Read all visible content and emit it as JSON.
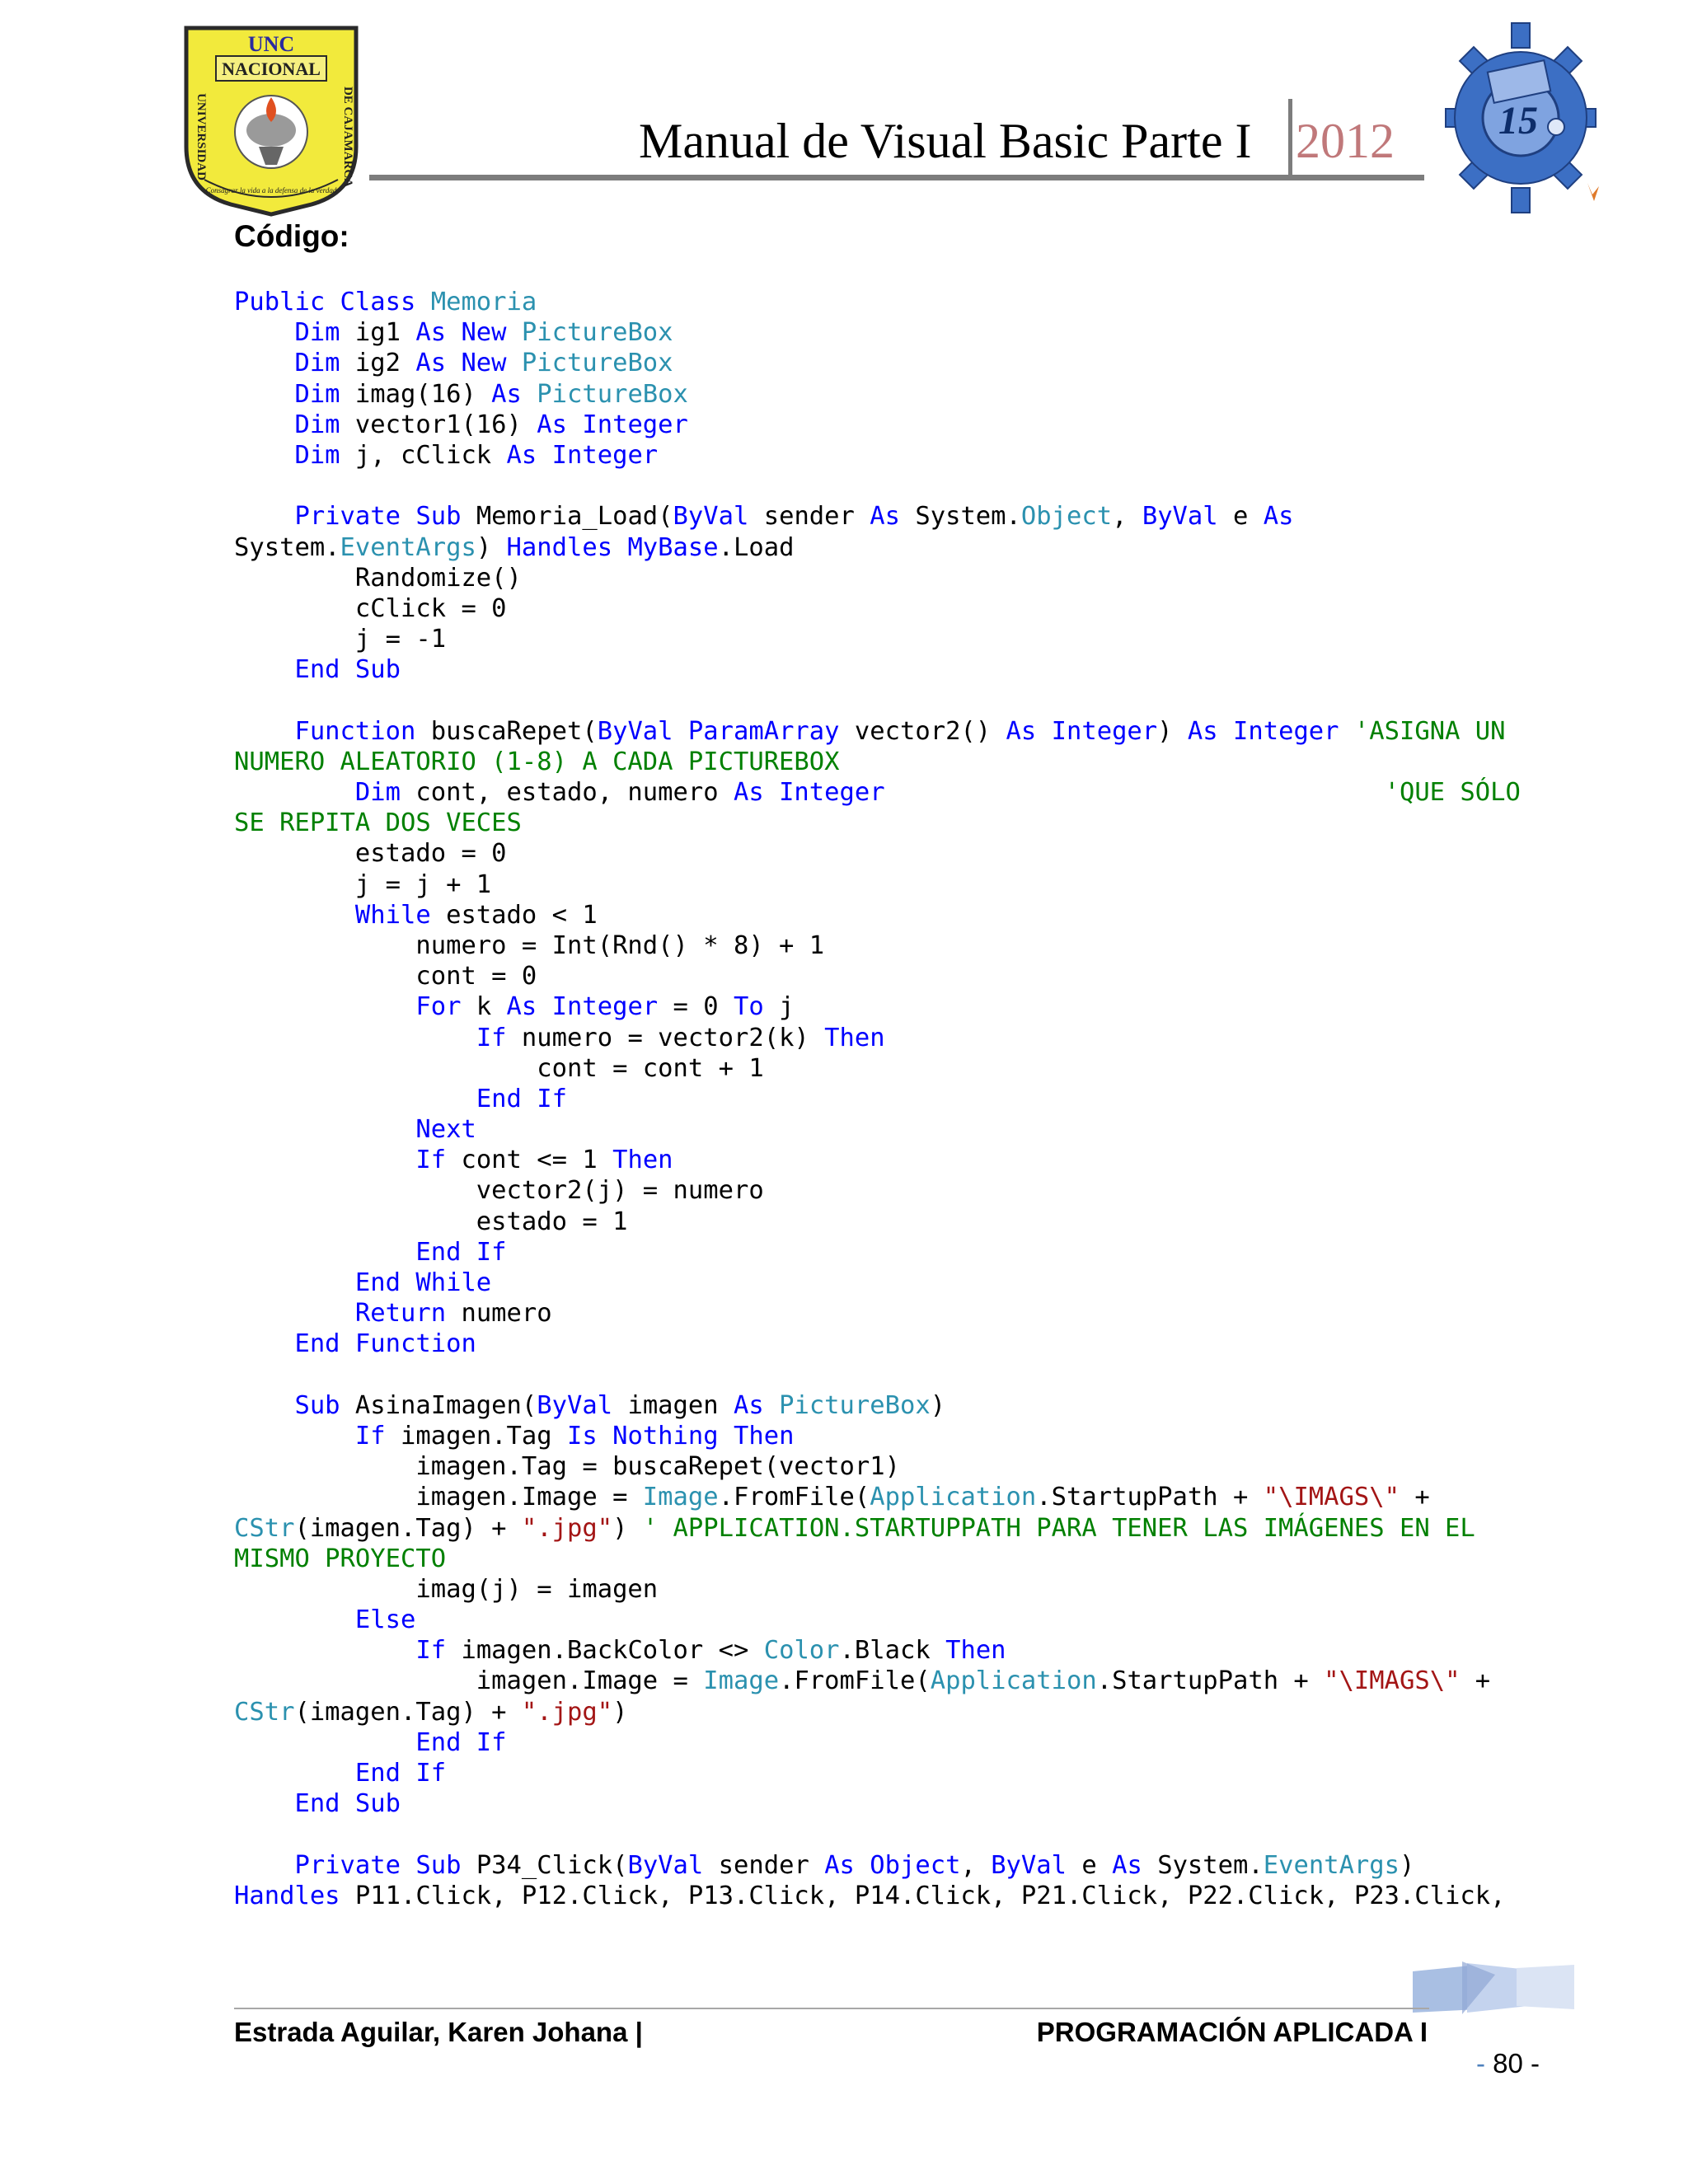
{
  "header": {
    "title": "Manual de Visual Basic Parte I",
    "year": "2012",
    "left_logo": {
      "name": "UNC Nacional de Cajamarca seal",
      "text_top": "UNC",
      "text_banner": "NACIONAL",
      "text_left": "UNIVERSIDAD",
      "text_right": "DE CAJAMARCA",
      "motto": "Consagrar la vida a la defensa de la verdad",
      "color_primary": "#f2ea3c",
      "color_border": "#2a2a2a"
    },
    "right_logo": {
      "name": "gear emblem logo",
      "text": "15",
      "color_primary": "#3c6fc4"
    }
  },
  "section_heading": "Código:",
  "code": {
    "colors": {
      "keyword": "#0000ff",
      "type": "#2b91af",
      "comment": "#008000",
      "string": "#a31515",
      "plain": "#000000"
    },
    "lines": [
      [
        [
          "k",
          "Public Class "
        ],
        [
          "t",
          "Memoria"
        ]
      ],
      [
        [
          "p",
          "    "
        ],
        [
          "k",
          "Dim "
        ],
        [
          "p",
          "ig1 "
        ],
        [
          "k",
          "As New "
        ],
        [
          "t",
          "PictureBox"
        ]
      ],
      [
        [
          "p",
          "    "
        ],
        [
          "k",
          "Dim "
        ],
        [
          "p",
          "ig2 "
        ],
        [
          "k",
          "As New "
        ],
        [
          "t",
          "PictureBox"
        ]
      ],
      [
        [
          "p",
          "    "
        ],
        [
          "k",
          "Dim "
        ],
        [
          "p",
          "imag(16) "
        ],
        [
          "k",
          "As "
        ],
        [
          "t",
          "PictureBox"
        ]
      ],
      [
        [
          "p",
          "    "
        ],
        [
          "k",
          "Dim "
        ],
        [
          "p",
          "vector1(16) "
        ],
        [
          "k",
          "As Integer"
        ]
      ],
      [
        [
          "p",
          "    "
        ],
        [
          "k",
          "Dim "
        ],
        [
          "p",
          "j, cClick "
        ],
        [
          "k",
          "As Integer"
        ]
      ],
      [],
      [
        [
          "p",
          "    "
        ],
        [
          "k",
          "Private Sub "
        ],
        [
          "p",
          "Memoria_Load("
        ],
        [
          "k",
          "ByVal "
        ],
        [
          "p",
          "sender "
        ],
        [
          "k",
          "As "
        ],
        [
          "p",
          "System."
        ],
        [
          "t",
          "Object"
        ],
        [
          "p",
          ", "
        ],
        [
          "k",
          "ByVal "
        ],
        [
          "p",
          "e "
        ],
        [
          "k",
          "As"
        ]
      ],
      [
        [
          "p",
          "System."
        ],
        [
          "t",
          "EventArgs"
        ],
        [
          "p",
          ") "
        ],
        [
          "k",
          "Handles MyBase"
        ],
        [
          "p",
          ".Load"
        ]
      ],
      [
        [
          "p",
          "        Randomize()"
        ]
      ],
      [
        [
          "p",
          "        cClick = 0"
        ]
      ],
      [
        [
          "p",
          "        j = -1"
        ]
      ],
      [
        [
          "p",
          "    "
        ],
        [
          "k",
          "End Sub"
        ]
      ],
      [],
      [
        [
          "p",
          "    "
        ],
        [
          "k",
          "Function "
        ],
        [
          "p",
          "buscaRepet("
        ],
        [
          "k",
          "ByVal ParamArray "
        ],
        [
          "p",
          "vector2() "
        ],
        [
          "k",
          "As Integer"
        ],
        [
          "p",
          ") "
        ],
        [
          "k",
          "As Integer "
        ],
        [
          "c",
          "'ASIGNA UN"
        ]
      ],
      [
        [
          "c",
          "NUMERO ALEATORIO (1-8) A CADA PICTUREBOX"
        ]
      ],
      [
        [
          "p",
          "        "
        ],
        [
          "k",
          "Dim "
        ],
        [
          "p",
          "cont, estado, numero "
        ],
        [
          "k",
          "As Integer"
        ],
        [
          "p",
          "                                 "
        ],
        [
          "c",
          "'QUE SÓLO"
        ]
      ],
      [
        [
          "c",
          "SE REPITA DOS VECES"
        ]
      ],
      [
        [
          "p",
          "        estado = 0"
        ]
      ],
      [
        [
          "p",
          "        j = j + 1"
        ]
      ],
      [
        [
          "p",
          "        "
        ],
        [
          "k",
          "While "
        ],
        [
          "p",
          "estado < 1"
        ]
      ],
      [
        [
          "p",
          "            numero = Int(Rnd() * 8) + 1"
        ]
      ],
      [
        [
          "p",
          "            cont = 0"
        ]
      ],
      [
        [
          "p",
          "            "
        ],
        [
          "k",
          "For "
        ],
        [
          "p",
          "k "
        ],
        [
          "k",
          "As Integer "
        ],
        [
          "p",
          "= 0 "
        ],
        [
          "k",
          "To "
        ],
        [
          "p",
          "j"
        ]
      ],
      [
        [
          "p",
          "                "
        ],
        [
          "k",
          "If "
        ],
        [
          "p",
          "numero = vector2(k) "
        ],
        [
          "k",
          "Then"
        ]
      ],
      [
        [
          "p",
          "                    cont = cont + 1"
        ]
      ],
      [
        [
          "p",
          "                "
        ],
        [
          "k",
          "End If"
        ]
      ],
      [
        [
          "p",
          "            "
        ],
        [
          "k",
          "Next"
        ]
      ],
      [
        [
          "p",
          "            "
        ],
        [
          "k",
          "If "
        ],
        [
          "p",
          "cont <= 1 "
        ],
        [
          "k",
          "Then"
        ]
      ],
      [
        [
          "p",
          "                vector2(j) = numero"
        ]
      ],
      [
        [
          "p",
          "                estado = 1"
        ]
      ],
      [
        [
          "p",
          "            "
        ],
        [
          "k",
          "End If"
        ]
      ],
      [
        [
          "p",
          "        "
        ],
        [
          "k",
          "End While"
        ]
      ],
      [
        [
          "p",
          "        "
        ],
        [
          "k",
          "Return "
        ],
        [
          "p",
          "numero"
        ]
      ],
      [
        [
          "p",
          "    "
        ],
        [
          "k",
          "End Function"
        ]
      ],
      [],
      [
        [
          "p",
          "    "
        ],
        [
          "k",
          "Sub "
        ],
        [
          "p",
          "AsinaImagen("
        ],
        [
          "k",
          "ByVal "
        ],
        [
          "p",
          "imagen "
        ],
        [
          "k",
          "As "
        ],
        [
          "t",
          "PictureBox"
        ],
        [
          "p",
          ")"
        ]
      ],
      [
        [
          "p",
          "        "
        ],
        [
          "k",
          "If "
        ],
        [
          "p",
          "imagen.Tag "
        ],
        [
          "k",
          "Is Nothing Then"
        ]
      ],
      [
        [
          "p",
          "            imagen.Tag = buscaRepet(vector1)"
        ]
      ],
      [
        [
          "p",
          "            imagen.Image = "
        ],
        [
          "t",
          "Image"
        ],
        [
          "p",
          ".FromFile("
        ],
        [
          "t",
          "Application"
        ],
        [
          "p",
          ".StartupPath + "
        ],
        [
          "s",
          "\"\\IMAGS\\\""
        ],
        [
          "p",
          " +"
        ]
      ],
      [
        [
          "t",
          "CStr"
        ],
        [
          "p",
          "(imagen.Tag) + "
        ],
        [
          "s",
          "\".jpg\""
        ],
        [
          "p",
          ") "
        ],
        [
          "c",
          "' APPLICATION.STARTUPPATH PARA TENER LAS IMÁGENES EN EL"
        ]
      ],
      [
        [
          "c",
          "MISMO PROYECTO"
        ]
      ],
      [
        [
          "p",
          "            imag(j) = imagen"
        ]
      ],
      [
        [
          "p",
          "        "
        ],
        [
          "k",
          "Else"
        ]
      ],
      [
        [
          "p",
          "            "
        ],
        [
          "k",
          "If "
        ],
        [
          "p",
          "imagen.BackColor <> "
        ],
        [
          "t",
          "Color"
        ],
        [
          "p",
          ".Black "
        ],
        [
          "k",
          "Then"
        ]
      ],
      [
        [
          "p",
          "                imagen.Image = "
        ],
        [
          "t",
          "Image"
        ],
        [
          "p",
          ".FromFile("
        ],
        [
          "t",
          "Application"
        ],
        [
          "p",
          ".StartupPath + "
        ],
        [
          "s",
          "\"\\IMAGS\\\""
        ],
        [
          "p",
          " +"
        ]
      ],
      [
        [
          "t",
          "CStr"
        ],
        [
          "p",
          "(imagen.Tag) + "
        ],
        [
          "s",
          "\".jpg\""
        ],
        [
          "p",
          ")"
        ]
      ],
      [
        [
          "p",
          "            "
        ],
        [
          "k",
          "End If"
        ]
      ],
      [
        [
          "p",
          "        "
        ],
        [
          "k",
          "End If"
        ]
      ],
      [
        [
          "p",
          "    "
        ],
        [
          "k",
          "End Sub"
        ]
      ],
      [],
      [
        [
          "p",
          "    "
        ],
        [
          "k",
          "Private Sub "
        ],
        [
          "p",
          "P34_Click("
        ],
        [
          "k",
          "ByVal "
        ],
        [
          "p",
          "sender "
        ],
        [
          "k",
          "As Object"
        ],
        [
          "p",
          ", "
        ],
        [
          "k",
          "ByVal "
        ],
        [
          "p",
          "e "
        ],
        [
          "k",
          "As "
        ],
        [
          "p",
          "System."
        ],
        [
          "t",
          "EventArgs"
        ],
        [
          "p",
          ")"
        ]
      ],
      [
        [
          "k",
          "Handles "
        ],
        [
          "p",
          "P11.Click, P12.Click, P13.Click, P14.Click, P21.Click, P22.Click, P23.Click,"
        ]
      ]
    ]
  },
  "footer": {
    "author": "Estrada Aguilar, Karen Johana |",
    "course": "PROGRAMACIÓN APLICADA I",
    "page_dash_left": "-",
    "page_number": " 80 ",
    "page_dash_right": "-"
  }
}
